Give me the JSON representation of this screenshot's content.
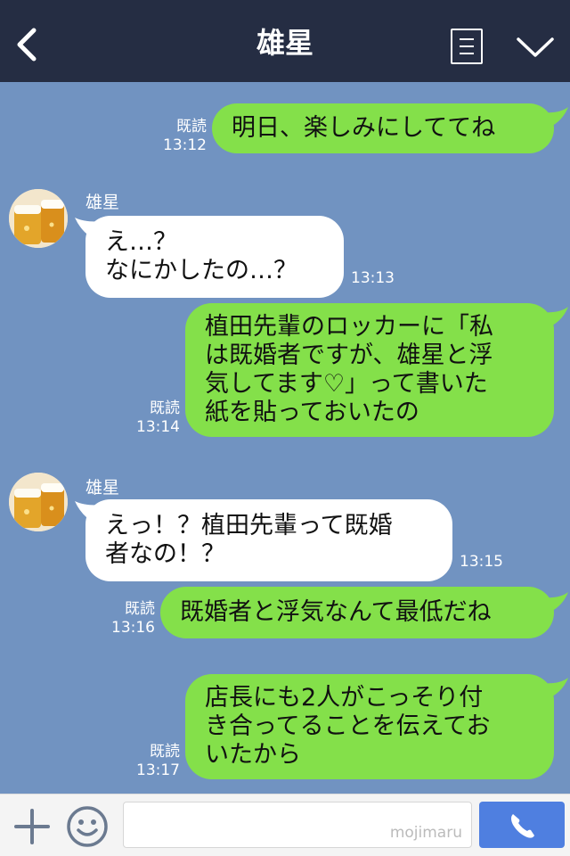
{
  "header": {
    "title": "雄星",
    "icons": {
      "back": "chevron-left-icon",
      "menu": "list-menu-icon",
      "expand": "chevron-down-icon"
    },
    "colors": {
      "background": "#252d43"
    }
  },
  "chat": {
    "background": "#7193c1",
    "messages": [
      {
        "sender": "me",
        "text": "明日、楽しみにしててね",
        "read": "既読",
        "time": "13:12"
      },
      {
        "sender": "them",
        "name": "雄星",
        "text": "え…？\nなにかしたの…？",
        "time": "13:13"
      },
      {
        "sender": "me",
        "text": "植田先輩のロッカーに「私\nは既婚者ですが、雄星と浮\n気してます♡」って書いた\n紙を貼っておいたの",
        "read": "既読",
        "time": "13:14"
      },
      {
        "sender": "them",
        "name": "雄星",
        "text": "えっ！？植田先輩って既婚\n者なの！？",
        "time": "13:15"
      },
      {
        "sender": "me",
        "text": "既婚者と浮気なんて最低だね",
        "read": "既読",
        "time": "13:16"
      },
      {
        "sender": "me",
        "text": "店長にも2人がこっそり付\nき合ってることを伝えてお\nいたから",
        "read": "既読",
        "time": "13:17"
      }
    ],
    "colors": {
      "mine": "#84e04a",
      "theirs": "#ffffff"
    }
  },
  "input": {
    "watermark": "mojimaru",
    "icons": {
      "add": "plus-icon",
      "sticker": "smiley-icon",
      "send": "phone-icon"
    },
    "colors": {
      "send": "#4f7fe0"
    }
  }
}
